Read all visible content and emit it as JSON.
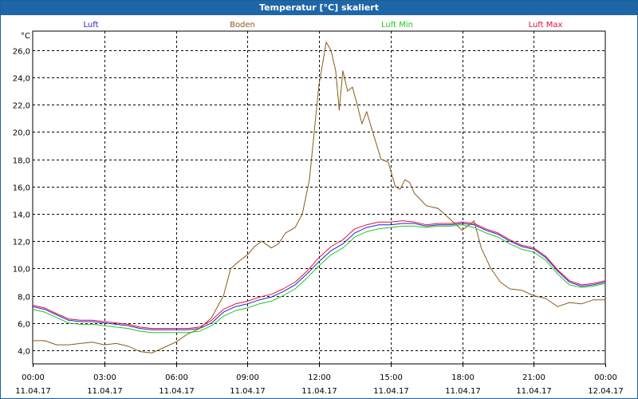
{
  "window": {
    "title": "Temperatur [°C] skaliert"
  },
  "chart_data": {
    "type": "line",
    "unit_label": "°C",
    "ylim": [
      3.0,
      27.4
    ],
    "y_ticks": [
      4.0,
      6.0,
      8.0,
      10.0,
      12.0,
      14.0,
      16.0,
      18.0,
      20.0,
      22.0,
      24.0,
      26.0
    ],
    "y_tick_labels": [
      "4,0",
      "6,0",
      "8,0",
      "10,0",
      "12,0",
      "14,0",
      "16,0",
      "18,0",
      "20,0",
      "22,0",
      "24,0",
      "26,0"
    ],
    "xlim_hours": [
      0,
      24
    ],
    "x_ticks": [
      {
        "h": 0,
        "time": "00:00",
        "date": "11.04.17"
      },
      {
        "h": 3,
        "time": "03:00",
        "date": "11.04.17"
      },
      {
        "h": 6,
        "time": "06:00",
        "date": "11.04.17"
      },
      {
        "h": 9,
        "time": "09:00",
        "date": "11.04.17"
      },
      {
        "h": 12,
        "time": "12:00",
        "date": "11.04.17"
      },
      {
        "h": 15,
        "time": "15:00",
        "date": "11.04.17"
      },
      {
        "h": 18,
        "time": "18:00",
        "date": "11.04.17"
      },
      {
        "h": 21,
        "time": "21:00",
        "date": "11.04.17"
      },
      {
        "h": 24,
        "time": "00:00",
        "date": "12.04.17"
      }
    ],
    "grid": true,
    "legend_position": "top",
    "series": [
      {
        "name": "Luft",
        "color": "#2a1fd0",
        "points": [
          [
            0,
            7.2
          ],
          [
            0.5,
            7.0
          ],
          [
            1.0,
            6.6
          ],
          [
            1.5,
            6.2
          ],
          [
            2.0,
            6.1
          ],
          [
            2.5,
            6.1
          ],
          [
            3.0,
            6.0
          ],
          [
            3.5,
            5.9
          ],
          [
            4.0,
            5.8
          ],
          [
            4.5,
            5.6
          ],
          [
            5.0,
            5.5
          ],
          [
            5.5,
            5.5
          ],
          [
            6.0,
            5.5
          ],
          [
            6.5,
            5.5
          ],
          [
            7.0,
            5.6
          ],
          [
            7.5,
            6.0
          ],
          [
            8.0,
            6.8
          ],
          [
            8.5,
            7.2
          ],
          [
            9.0,
            7.4
          ],
          [
            9.5,
            7.7
          ],
          [
            10.0,
            7.9
          ],
          [
            10.5,
            8.3
          ],
          [
            11.0,
            8.8
          ],
          [
            11.5,
            9.6
          ],
          [
            12.0,
            10.5
          ],
          [
            12.5,
            11.3
          ],
          [
            13.0,
            11.8
          ],
          [
            13.5,
            12.6
          ],
          [
            14.0,
            13.0
          ],
          [
            14.5,
            13.2
          ],
          [
            15.0,
            13.2
          ],
          [
            15.5,
            13.3
          ],
          [
            16.0,
            13.3
          ],
          [
            16.5,
            13.1
          ],
          [
            17.0,
            13.2
          ],
          [
            17.5,
            13.2
          ],
          [
            18.0,
            13.3
          ],
          [
            18.5,
            13.2
          ],
          [
            19.0,
            12.8
          ],
          [
            19.5,
            12.5
          ],
          [
            20.0,
            12.0
          ],
          [
            20.5,
            11.6
          ],
          [
            21.0,
            11.4
          ],
          [
            21.5,
            10.8
          ],
          [
            22.0,
            9.8
          ],
          [
            22.5,
            9.0
          ],
          [
            23.0,
            8.7
          ],
          [
            23.5,
            8.8
          ],
          [
            24.0,
            9.0
          ]
        ]
      },
      {
        "name": "Boden",
        "color": "#8b5a1a",
        "points": [
          [
            0,
            4.7
          ],
          [
            0.5,
            4.7
          ],
          [
            1.0,
            4.4
          ],
          [
            1.5,
            4.4
          ],
          [
            2.0,
            4.5
          ],
          [
            2.5,
            4.6
          ],
          [
            3.0,
            4.4
          ],
          [
            3.5,
            4.5
          ],
          [
            4.0,
            4.3
          ],
          [
            4.5,
            3.9
          ],
          [
            5.0,
            3.8
          ],
          [
            5.5,
            4.2
          ],
          [
            6.0,
            4.6
          ],
          [
            6.5,
            5.2
          ],
          [
            7.0,
            5.6
          ],
          [
            7.5,
            6.4
          ],
          [
            8.0,
            8.0
          ],
          [
            8.3,
            10.0
          ],
          [
            8.7,
            10.6
          ],
          [
            9.0,
            11.0
          ],
          [
            9.3,
            11.6
          ],
          [
            9.6,
            12.0
          ],
          [
            10.0,
            11.5
          ],
          [
            10.3,
            11.8
          ],
          [
            10.6,
            12.6
          ],
          [
            11.0,
            13.0
          ],
          [
            11.3,
            14.0
          ],
          [
            11.6,
            16.5
          ],
          [
            11.8,
            20.0
          ],
          [
            12.0,
            23.5
          ],
          [
            12.15,
            25.0
          ],
          [
            12.3,
            26.6
          ],
          [
            12.5,
            26.0
          ],
          [
            12.7,
            24.5
          ],
          [
            12.85,
            21.6
          ],
          [
            13.0,
            24.5
          ],
          [
            13.2,
            23.0
          ],
          [
            13.4,
            23.3
          ],
          [
            13.6,
            22.0
          ],
          [
            13.8,
            20.6
          ],
          [
            14.0,
            21.5
          ],
          [
            14.2,
            20.3
          ],
          [
            14.6,
            18.0
          ],
          [
            14.9,
            17.8
          ],
          [
            15.2,
            16.0
          ],
          [
            15.4,
            15.8
          ],
          [
            15.6,
            16.5
          ],
          [
            15.8,
            16.3
          ],
          [
            16.0,
            15.5
          ],
          [
            16.5,
            14.6
          ],
          [
            17.0,
            14.4
          ],
          [
            17.5,
            13.6
          ],
          [
            18.0,
            12.8
          ],
          [
            18.3,
            13.2
          ],
          [
            18.5,
            13.5
          ],
          [
            18.8,
            11.5
          ],
          [
            19.2,
            10.0
          ],
          [
            19.6,
            9.0
          ],
          [
            20.0,
            8.5
          ],
          [
            20.5,
            8.4
          ],
          [
            21.0,
            8.0
          ],
          [
            21.5,
            7.8
          ],
          [
            22.0,
            7.2
          ],
          [
            22.5,
            7.5
          ],
          [
            23.0,
            7.4
          ],
          [
            23.5,
            7.7
          ],
          [
            24.0,
            7.7
          ]
        ]
      },
      {
        "name": "Luft Min",
        "color": "#1ec81e",
        "points": [
          [
            0,
            7.0
          ],
          [
            0.5,
            6.8
          ],
          [
            1.0,
            6.4
          ],
          [
            1.5,
            6.0
          ],
          [
            2.0,
            5.9
          ],
          [
            2.5,
            5.9
          ],
          [
            3.0,
            5.8
          ],
          [
            3.5,
            5.7
          ],
          [
            4.0,
            5.6
          ],
          [
            4.5,
            5.4
          ],
          [
            5.0,
            5.3
          ],
          [
            5.5,
            5.3
          ],
          [
            6.0,
            5.3
          ],
          [
            6.5,
            5.3
          ],
          [
            7.0,
            5.4
          ],
          [
            7.5,
            5.8
          ],
          [
            8.0,
            6.5
          ],
          [
            8.5,
            6.9
          ],
          [
            9.0,
            7.1
          ],
          [
            9.5,
            7.4
          ],
          [
            10.0,
            7.6
          ],
          [
            10.5,
            8.0
          ],
          [
            11.0,
            8.5
          ],
          [
            11.5,
            9.3
          ],
          [
            12.0,
            10.2
          ],
          [
            12.5,
            11.0
          ],
          [
            13.0,
            11.5
          ],
          [
            13.5,
            12.3
          ],
          [
            14.0,
            12.7
          ],
          [
            14.5,
            12.9
          ],
          [
            15.0,
            13.0
          ],
          [
            15.5,
            13.1
          ],
          [
            16.0,
            13.1
          ],
          [
            16.5,
            13.0
          ],
          [
            17.0,
            13.1
          ],
          [
            17.5,
            13.1
          ],
          [
            18.0,
            13.2
          ],
          [
            18.5,
            13.0
          ],
          [
            19.0,
            12.6
          ],
          [
            19.5,
            12.3
          ],
          [
            20.0,
            11.8
          ],
          [
            20.5,
            11.4
          ],
          [
            21.0,
            11.2
          ],
          [
            21.5,
            10.6
          ],
          [
            22.0,
            9.6
          ],
          [
            22.5,
            8.8
          ],
          [
            23.0,
            8.6
          ],
          [
            23.5,
            8.7
          ],
          [
            24.0,
            8.9
          ]
        ]
      },
      {
        "name": "Luft Max",
        "color": "#e0103a",
        "points": [
          [
            0,
            7.3
          ],
          [
            0.5,
            7.1
          ],
          [
            1.0,
            6.7
          ],
          [
            1.5,
            6.3
          ],
          [
            2.0,
            6.2
          ],
          [
            2.5,
            6.2
          ],
          [
            3.0,
            6.1
          ],
          [
            3.5,
            6.0
          ],
          [
            4.0,
            5.9
          ],
          [
            4.5,
            5.7
          ],
          [
            5.0,
            5.6
          ],
          [
            5.5,
            5.6
          ],
          [
            6.0,
            5.6
          ],
          [
            6.5,
            5.6
          ],
          [
            7.0,
            5.7
          ],
          [
            7.5,
            6.2
          ],
          [
            8.0,
            7.0
          ],
          [
            8.5,
            7.4
          ],
          [
            9.0,
            7.6
          ],
          [
            9.5,
            7.9
          ],
          [
            10.0,
            8.1
          ],
          [
            10.5,
            8.5
          ],
          [
            11.0,
            9.0
          ],
          [
            11.5,
            9.8
          ],
          [
            12.0,
            10.8
          ],
          [
            12.5,
            11.6
          ],
          [
            13.0,
            12.1
          ],
          [
            13.5,
            12.9
          ],
          [
            14.0,
            13.2
          ],
          [
            14.5,
            13.4
          ],
          [
            15.0,
            13.4
          ],
          [
            15.5,
            13.5
          ],
          [
            16.0,
            13.4
          ],
          [
            16.5,
            13.2
          ],
          [
            17.0,
            13.3
          ],
          [
            17.5,
            13.3
          ],
          [
            18.0,
            13.4
          ],
          [
            18.5,
            13.3
          ],
          [
            19.0,
            12.9
          ],
          [
            19.5,
            12.6
          ],
          [
            20.0,
            12.1
          ],
          [
            20.5,
            11.7
          ],
          [
            21.0,
            11.5
          ],
          [
            21.5,
            10.9
          ],
          [
            22.0,
            9.9
          ],
          [
            22.5,
            9.1
          ],
          [
            23.0,
            8.8
          ],
          [
            23.5,
            8.9
          ],
          [
            24.0,
            9.1
          ]
        ]
      }
    ]
  }
}
